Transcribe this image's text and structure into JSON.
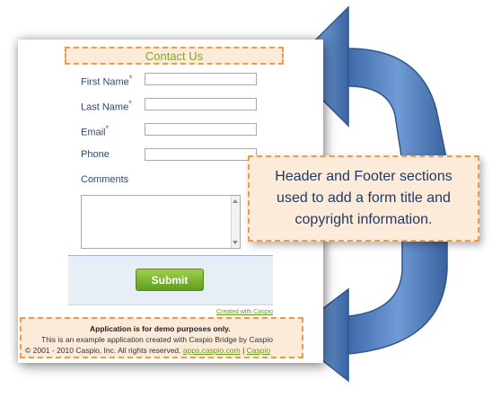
{
  "form": {
    "title": "Contact Us",
    "fields": [
      {
        "label": "First Name",
        "required": true
      },
      {
        "label": "Last Name",
        "required": true
      },
      {
        "label": "Email",
        "required": true
      },
      {
        "label": "Phone",
        "required": false
      }
    ],
    "comments_label": "Comments",
    "required_mark": "*",
    "submit_label": "Submit",
    "created_with": "Created with Caspio"
  },
  "footer": {
    "line1": "Application is for demo purposes only.",
    "line2": "This is an example application created with Caspio Bridge by Caspio",
    "line3_prefix": "© 2001 - 2010 Caspio, Inc. All rights reserved.",
    "link1": "apps.caspio.com",
    "separator": "|",
    "link2": "Caspio"
  },
  "callout": {
    "text": "Header and Footer sections used to add a form title and copyright information."
  },
  "colors": {
    "accent_orange": "#f29a4a",
    "arrow_blue": "#4f7fc0",
    "title_green": "#7fa628",
    "submit_green": "#6aab22"
  }
}
